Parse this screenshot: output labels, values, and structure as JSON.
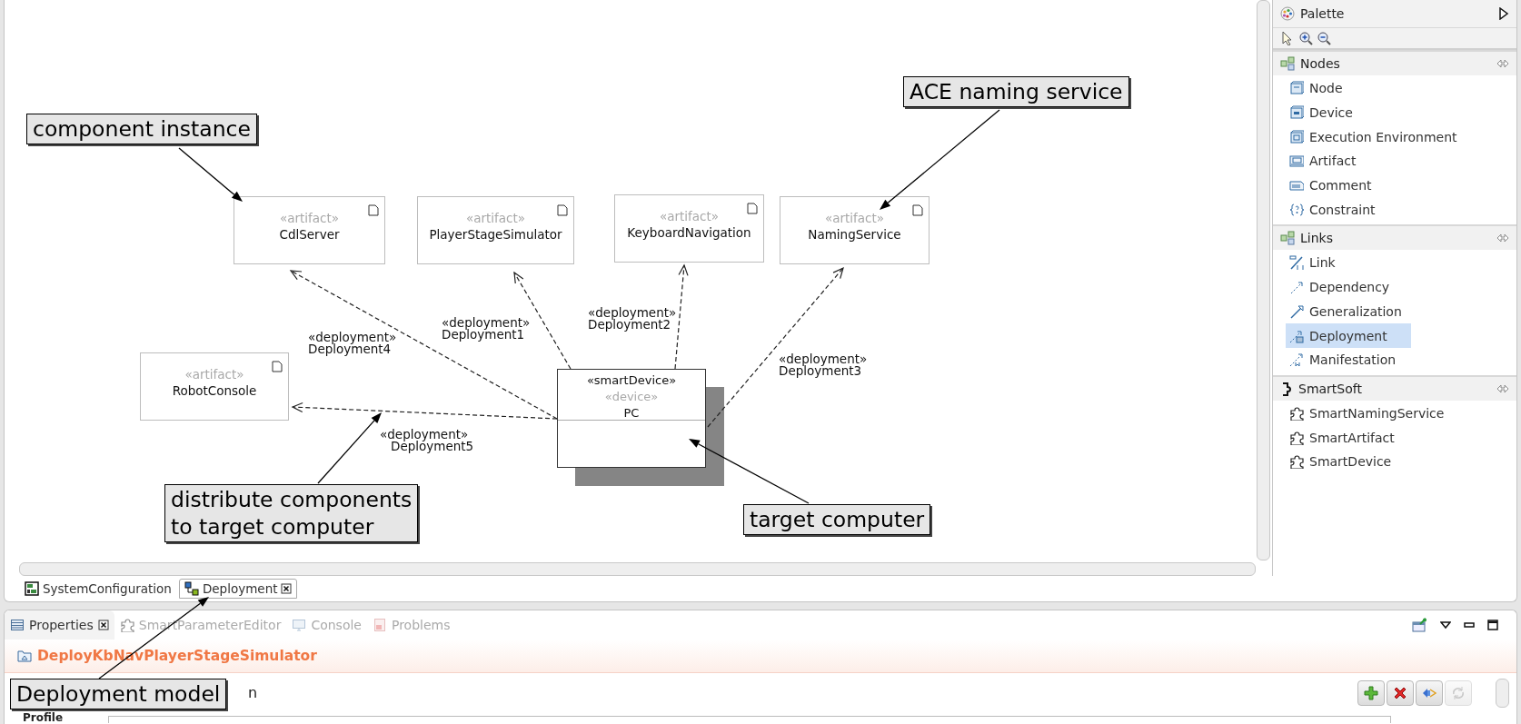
{
  "diagram": {
    "nodes": [
      {
        "kind": "artifact",
        "stereotypes": [
          "«artifact»"
        ],
        "name": "CdlServer"
      },
      {
        "kind": "artifact",
        "stereotypes": [
          "«artifact»"
        ],
        "name": "PlayerStageSimulator"
      },
      {
        "kind": "artifact",
        "stereotypes": [
          "«artifact»"
        ],
        "name": "KeyboardNavigation"
      },
      {
        "kind": "artifact",
        "stereotypes": [
          "«artifact»"
        ],
        "name": "NamingService"
      },
      {
        "kind": "artifact",
        "stereotypes": [
          "«artifact»"
        ],
        "name": "RobotConsole"
      },
      {
        "kind": "device",
        "stereotypes": [
          "«smartDevice»",
          "«device»"
        ],
        "name": "PC"
      }
    ],
    "links": [
      {
        "stereotype": "«deployment»",
        "name": "Deployment4"
      },
      {
        "stereotype": "«deployment»",
        "name": "Deployment1"
      },
      {
        "stereotype": "«deployment»",
        "name": "Deployment2"
      },
      {
        "stereotype": "«deployment»",
        "name": "Deployment3"
      },
      {
        "stereotype": "«deployment»",
        "name": "Deployment5"
      }
    ]
  },
  "callouts": [
    {
      "text": "component instance"
    },
    {
      "text": "ACE naming service"
    },
    {
      "text": "distribute components\nto target computer"
    },
    {
      "text": "target computer"
    },
    {
      "text": "Deployment model"
    }
  ],
  "editor_tabs": [
    {
      "label": "SystemConfiguration",
      "selected": false
    },
    {
      "label": "Deployment",
      "selected": true
    }
  ],
  "palette": {
    "title": "Palette",
    "sections": [
      {
        "title": "Nodes",
        "kind": "nodes",
        "items": [
          {
            "label": "Node",
            "kind": "node",
            "selected": false
          },
          {
            "label": "Device",
            "kind": "device",
            "selected": false
          },
          {
            "label": "Execution Environment",
            "kind": "environment",
            "selected": false
          },
          {
            "label": "Artifact",
            "kind": "artifact",
            "selected": false
          },
          {
            "label": "Comment",
            "kind": "comment",
            "selected": false
          },
          {
            "label": "Constraint",
            "kind": "constraint",
            "selected": false
          }
        ]
      },
      {
        "title": "Links",
        "kind": "links",
        "items": [
          {
            "label": "Link",
            "kind": "link",
            "selected": false
          },
          {
            "label": "Dependency",
            "kind": "dependency",
            "selected": false
          },
          {
            "label": "Generalization",
            "kind": "generalization",
            "selected": false
          },
          {
            "label": "Deployment",
            "kind": "deployment",
            "selected": true
          },
          {
            "label": "Manifestation",
            "kind": "manifestation",
            "selected": false
          }
        ]
      },
      {
        "title": "SmartSoft",
        "kind": "smartsoft",
        "items": [
          {
            "label": "SmartNamingService",
            "kind": "puzzle",
            "selected": false
          },
          {
            "label": "SmartArtifact",
            "kind": "puzzle",
            "selected": false
          },
          {
            "label": "SmartDevice",
            "kind": "puzzle",
            "selected": false
          }
        ]
      }
    ]
  },
  "properties": {
    "tabs": [
      {
        "label": "Properties",
        "kind": "properties",
        "selected": true
      },
      {
        "label": "SmartParameterEditor",
        "kind": "puzzle",
        "selected": false
      },
      {
        "label": "Console",
        "kind": "console",
        "selected": false
      },
      {
        "label": "Problems",
        "kind": "problems",
        "selected": false
      }
    ],
    "title": "DeployKbNavPlayerStageSimulator",
    "covered_text": "n",
    "field_label": "Profile",
    "buttons": [
      {
        "kind": "add",
        "disabled": false
      },
      {
        "kind": "remove",
        "disabled": false
      },
      {
        "kind": "browse",
        "disabled": false
      },
      {
        "kind": "refresh",
        "disabled": true
      }
    ]
  }
}
